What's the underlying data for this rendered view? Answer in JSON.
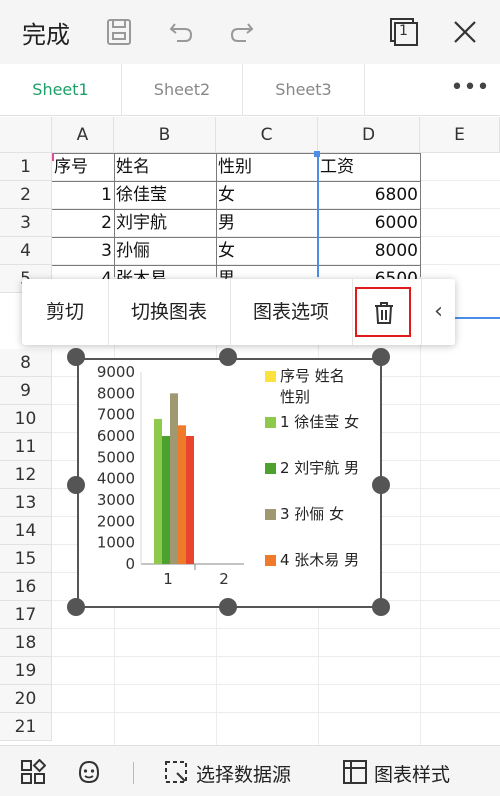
{
  "toolbar": {
    "done_label": "完成",
    "icons": [
      "save-icon",
      "undo-icon",
      "redo-icon",
      "window-count-icon",
      "close-icon"
    ],
    "window_count": "1"
  },
  "tabs": [
    {
      "label": "Sheet1",
      "active": true
    },
    {
      "label": "Sheet2",
      "active": false
    },
    {
      "label": "Sheet3",
      "active": false
    }
  ],
  "more_label": "•••",
  "columns": [
    "A",
    "B",
    "C",
    "D",
    "E"
  ],
  "rows": [
    "1",
    "2",
    "3",
    "4",
    "5",
    "8",
    "9",
    "10",
    "11",
    "12",
    "13",
    "14",
    "15",
    "16",
    "17",
    "18",
    "19",
    "20",
    "21"
  ],
  "cells": {
    "a1": "序号",
    "b1": "姓名",
    "c1": "性别",
    "d1": "工资",
    "a2": "1",
    "b2": "徐佳莹",
    "c2": "女",
    "d2": "6800",
    "a3": "2",
    "b3": "刘宇航",
    "c3": "男",
    "d3": "6000",
    "a4": "3",
    "b4": "孙俪",
    "c4": "女",
    "d4": "8000",
    "a5": "4",
    "b5": "张木易",
    "c5": "男",
    "d5": "6500"
  },
  "context_menu": {
    "cut": "剪切",
    "switch_chart": "切换图表",
    "chart_options": "图表选项",
    "delete_icon": "trash-icon",
    "collapse_icon": "chevron-left-icon",
    "collapse_glyph": "‹"
  },
  "chart_data": {
    "type": "bar",
    "categories": [
      "1",
      "2"
    ],
    "yticks": [
      "9000",
      "8000",
      "7000",
      "6000",
      "5000",
      "4000",
      "3000",
      "2000",
      "1000",
      "0"
    ],
    "ylim": [
      0,
      9000
    ],
    "series": [
      {
        "name": "序号 姓名 性别",
        "values": [
          null,
          null
        ],
        "color": "#fde13c"
      },
      {
        "name": "1 徐佳莹 女",
        "values": [
          6800,
          null
        ],
        "color": "#8dca4b"
      },
      {
        "name": "2 刘宇航 男",
        "values": [
          6000,
          null
        ],
        "color": "#4da12e"
      },
      {
        "name": "3 孙俪 女",
        "values": [
          8000,
          null
        ],
        "color": "#a09870"
      },
      {
        "name": "4 张木易 男",
        "values": [
          6500,
          null
        ],
        "color": "#ef7a29"
      },
      {
        "name": "",
        "values": [
          6000,
          null
        ],
        "color": "#e8452c"
      }
    ],
    "legend_lines": [
      {
        "line1": "序号 姓名",
        "line2": "性别"
      },
      {
        "line1": "1 徐佳莹 女",
        "line2": ""
      },
      {
        "line1": "2 刘宇航 男",
        "line2": ""
      },
      {
        "line1": "3 孙俪 女",
        "line2": ""
      },
      {
        "line1": "4 张木易 男",
        "line2": ""
      }
    ],
    "legend_position": "right"
  },
  "bottombar": {
    "select_source": "选择数据源",
    "chart_style": "图表样式",
    "icons": [
      "apps-grid-icon",
      "assistant-face-icon",
      "select-range-icon",
      "chart-style-icon"
    ]
  },
  "colors": {
    "accent": "#1e9f6a",
    "highlight": "#e01b1b",
    "selection": "#4a8ee8"
  }
}
